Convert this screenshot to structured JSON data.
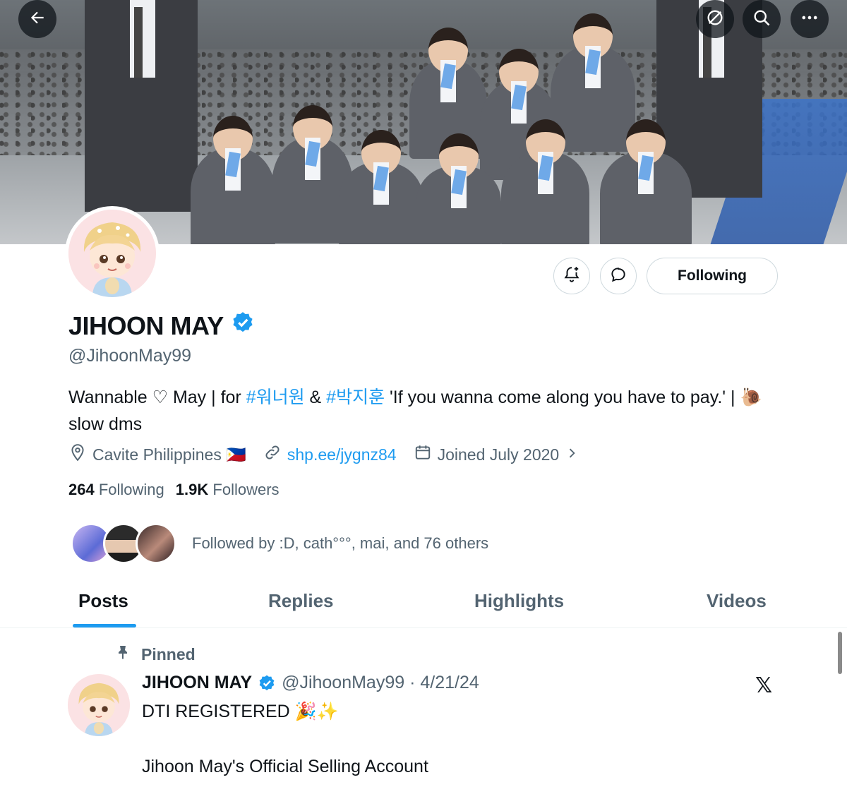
{
  "profile": {
    "display_name": "JIHOON MAY",
    "handle": "@JihoonMay99",
    "bio_part1": "Wannable ♡ May | for ",
    "hashtag1": "#워너원",
    "bio_amp": " & ",
    "hashtag2": "#박지훈",
    "bio_part2": " 'If you wanna come along you have to pay.' | 🐌 slow dms",
    "location": "Cavite Philippines 🇵🇭",
    "website": "shp.ee/jygnz84",
    "joined": "Joined July 2020",
    "following_count": "264",
    "following_label": "Following",
    "followers_count": "1.9K",
    "followers_label": "Followers",
    "followed_by": "Followed by :D, cath°°°, mai, and 76 others",
    "follow_button": "Following"
  },
  "tabs": [
    "Posts",
    "Replies",
    "Highlights",
    "Videos"
  ],
  "pinned_post": {
    "pinned_label": "Pinned",
    "author": "JIHOON MAY",
    "handle_date": "@JihoonMay99 · 4/21/24",
    "line1": "DTI REGISTERED 🎉✨",
    "line2": "Jihoon May's Official Selling Account"
  },
  "colors": {
    "accent": "#1d9bf0",
    "muted": "#536471",
    "text": "#0f1419"
  },
  "icons": {
    "top_left": "back-arrow-icon",
    "top_right": [
      "grok-circle-icon",
      "search-icon",
      "more-icon"
    ],
    "actions": [
      "notification-bell-add-icon",
      "message-icon"
    ],
    "meta": [
      "location-pin-icon",
      "link-icon",
      "calendar-icon"
    ]
  }
}
